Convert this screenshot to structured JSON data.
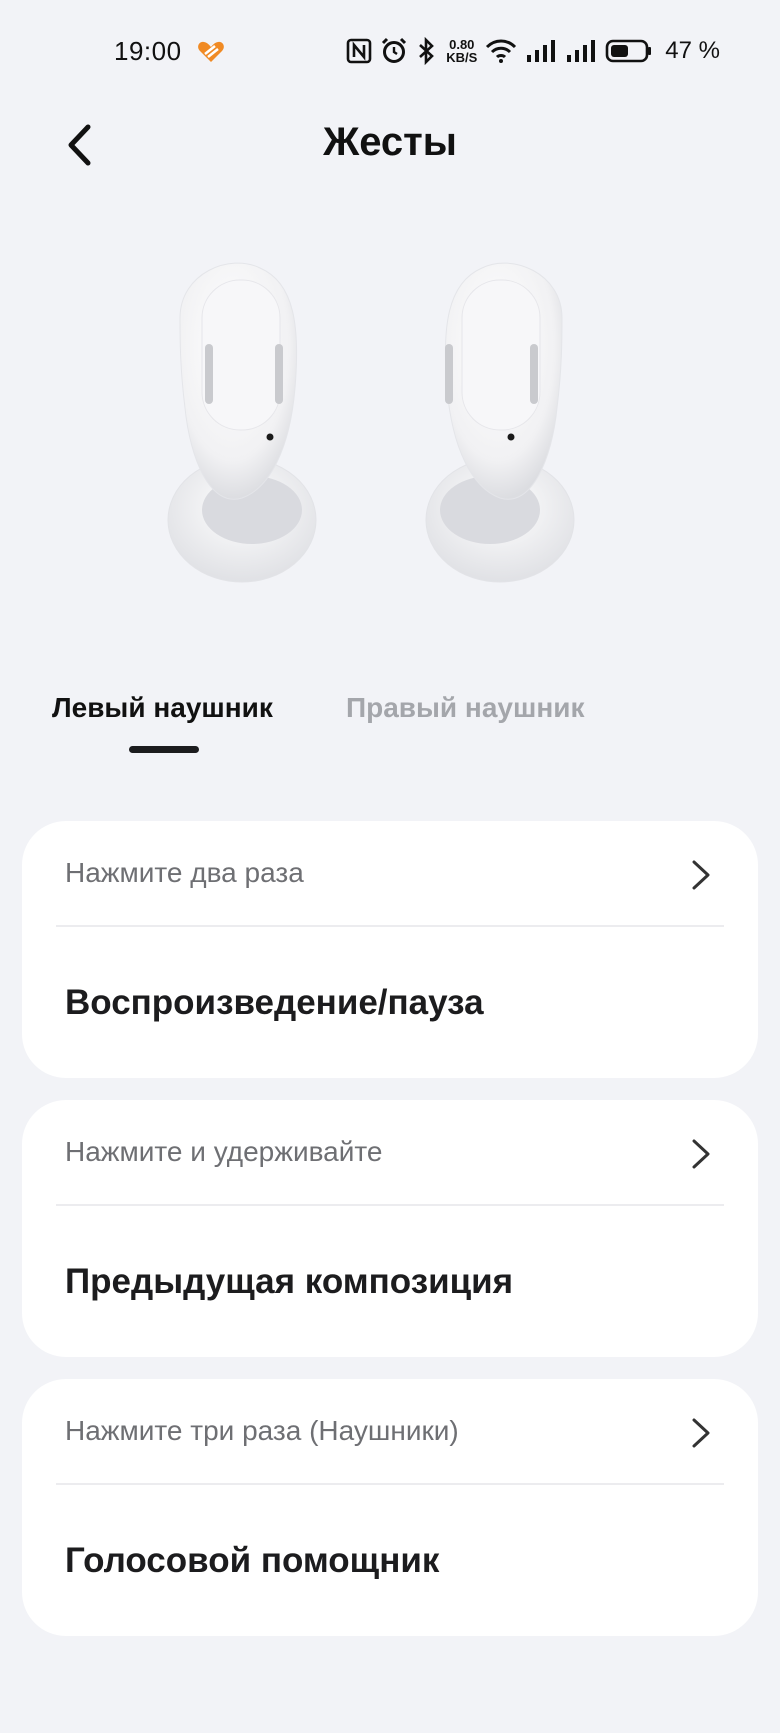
{
  "status_bar": {
    "time": "19:00",
    "net_speed_value": "0.80",
    "net_speed_unit": "KB/S",
    "battery_text": "47 %",
    "icons": [
      "heart-app-icon",
      "nfc-icon",
      "alarm-icon",
      "bluetooth-icon",
      "wifi-icon",
      "signal-icon",
      "signal-icon",
      "battery-icon"
    ]
  },
  "header": {
    "title": "Жесты",
    "back_icon": "chevron-left-icon"
  },
  "tabs": [
    {
      "label": "Левый наушник",
      "active": true
    },
    {
      "label": "Правый наушник",
      "active": false
    }
  ],
  "gestures": [
    {
      "label": "Нажмите два раза",
      "value": "Воспроизведение/пауза"
    },
    {
      "label": "Нажмите и удерживайте",
      "value": "Предыдущая композиция"
    },
    {
      "label": "Нажмите три раза (Наушники)",
      "value": "Голосовой помощник"
    }
  ],
  "colors": {
    "background": "#f2f3f7",
    "card": "#ffffff",
    "active_tab": "#111111",
    "inactive_tab": "#a4a6ab",
    "accent_heart": "#f08a24"
  }
}
